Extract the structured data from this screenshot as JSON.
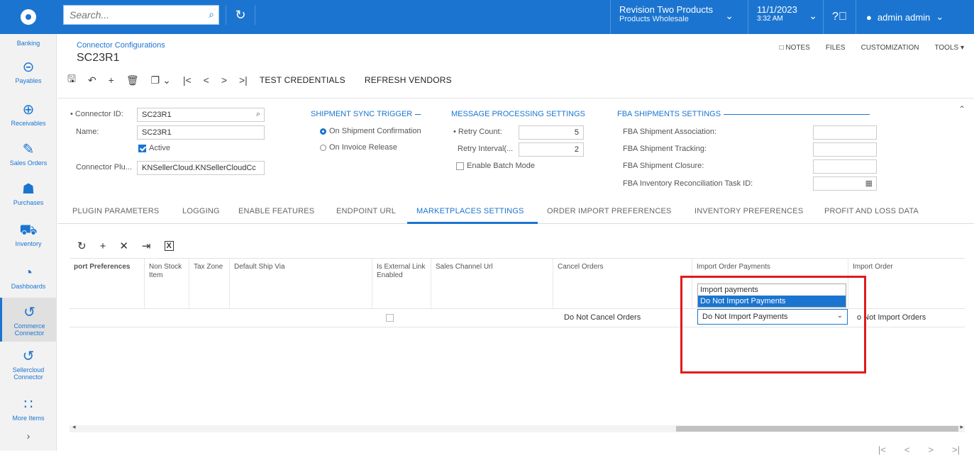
{
  "topbar": {
    "search_placeholder": "Search...",
    "company_name": "Revision Two Products",
    "company_branch": "Products Wholesale",
    "date": "11/1/2023",
    "time": "3:32 AM",
    "user": "admin admin"
  },
  "sidebar": {
    "items": [
      {
        "label": "Banking",
        "icon": "bank-icon"
      },
      {
        "label": "Payables",
        "icon": "minus-circle-icon"
      },
      {
        "label": "Receivables",
        "icon": "plus-circle-icon"
      },
      {
        "label": "Sales Orders",
        "icon": "pencil-icon"
      },
      {
        "label": "Purchases",
        "icon": "cart-icon"
      },
      {
        "label": "Inventory",
        "icon": "truck-icon"
      },
      {
        "label": "Dashboards",
        "icon": "gauge-icon"
      },
      {
        "label": "Commerce Connector",
        "icon": "sync-icon"
      },
      {
        "label": "Sellercloud Connector",
        "icon": "sync-icon"
      },
      {
        "label": "More Items",
        "icon": "grid-icon"
      }
    ]
  },
  "header": {
    "breadcrumb": "Connector Configurations",
    "title": "SC23R1",
    "right_tools": [
      "NOTES",
      "FILES",
      "CUSTOMIZATION",
      "TOOLS"
    ]
  },
  "toolbar": {
    "test_credentials": "TEST CREDENTIALS",
    "refresh_vendors": "REFRESH VENDORS"
  },
  "form": {
    "connector_id_label": "• Connector ID:",
    "connector_id": "SC23R1",
    "name_label": "Name:",
    "name": "SC23R1",
    "active_label": "Active",
    "active": true,
    "plugin_label": "Connector Plu...",
    "plugin": "KNSellerCloud.KNSellerCloudCc",
    "shipment_sync_title": "SHIPMENT SYNC TRIGGER",
    "on_shipment_confirmation": "On Shipment Confirmation",
    "on_invoice_release": "On Invoice Release",
    "message_processing_title": "MESSAGE PROCESSING SETTINGS",
    "retry_count_label": "• Retry Count:",
    "retry_count": "5",
    "retry_interval_label": "Retry Interval(...",
    "retry_interval": "2",
    "enable_batch_mode": "Enable Batch Mode",
    "fba_title": "FBA SHIPMENTS SETTINGS",
    "fba_association": "FBA Shipment Association:",
    "fba_tracking": "FBA Shipment Tracking:",
    "fba_closure": "FBA Shipment Closure:",
    "fba_reconciliation": "FBA Inventory Reconciliation Task ID:"
  },
  "tabs": [
    "PLUGIN PARAMETERS",
    "LOGGING",
    "ENABLE FEATURES",
    "ENDPOINT URL",
    "MARKETPLACES SETTINGS",
    "ORDER IMPORT PREFERENCES",
    "INVENTORY PREFERENCES",
    "PROFIT AND LOSS DATA"
  ],
  "grid": {
    "headers": {
      "import_preferences": "port Preferences",
      "non_stock_item": "Non Stock Item",
      "tax_zone": "Tax Zone",
      "default_ship_via": "Default Ship Via",
      "is_external": "Is External Link Enabled",
      "sales_channel_url": "Sales Channel Url",
      "cancel_orders": "Cancel Orders",
      "import_order_payments": "Import Order Payments",
      "import_order": "Import Order"
    },
    "row": {
      "cancel_orders": "Do Not Cancel Orders",
      "import_order_payments": "Do Not Import Payments",
      "import_order": "o Not Import Orders"
    },
    "dropdown_options": [
      "Import payments",
      "Do Not Import Payments"
    ]
  },
  "colors": {
    "accent": "#1b75d0",
    "highlight_box": "#e01b1b"
  }
}
